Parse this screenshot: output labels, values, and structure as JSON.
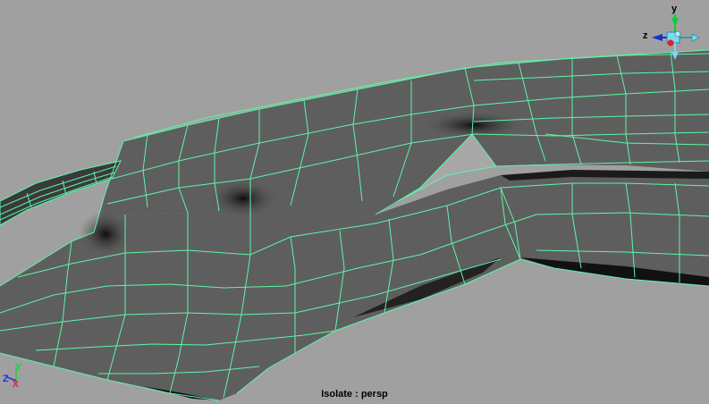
{
  "viewport": {
    "hud_label": "Isolate : persp",
    "background_color": "#a0a0a0",
    "mesh_fill_color": "#5e5e5e",
    "wireframe_color": "#5cf5a8"
  },
  "view_cube": {
    "y_label": "y",
    "z_label": "z",
    "y_color": "#11cc33",
    "z_color": "#1133cc",
    "x_color": "#dd2222"
  },
  "corner_axis": {
    "y_label": "Y",
    "z_label": "Z",
    "x_label": "X",
    "y_color": "#22cc44",
    "z_color": "#2233dd",
    "x_color": "#dd2222"
  }
}
